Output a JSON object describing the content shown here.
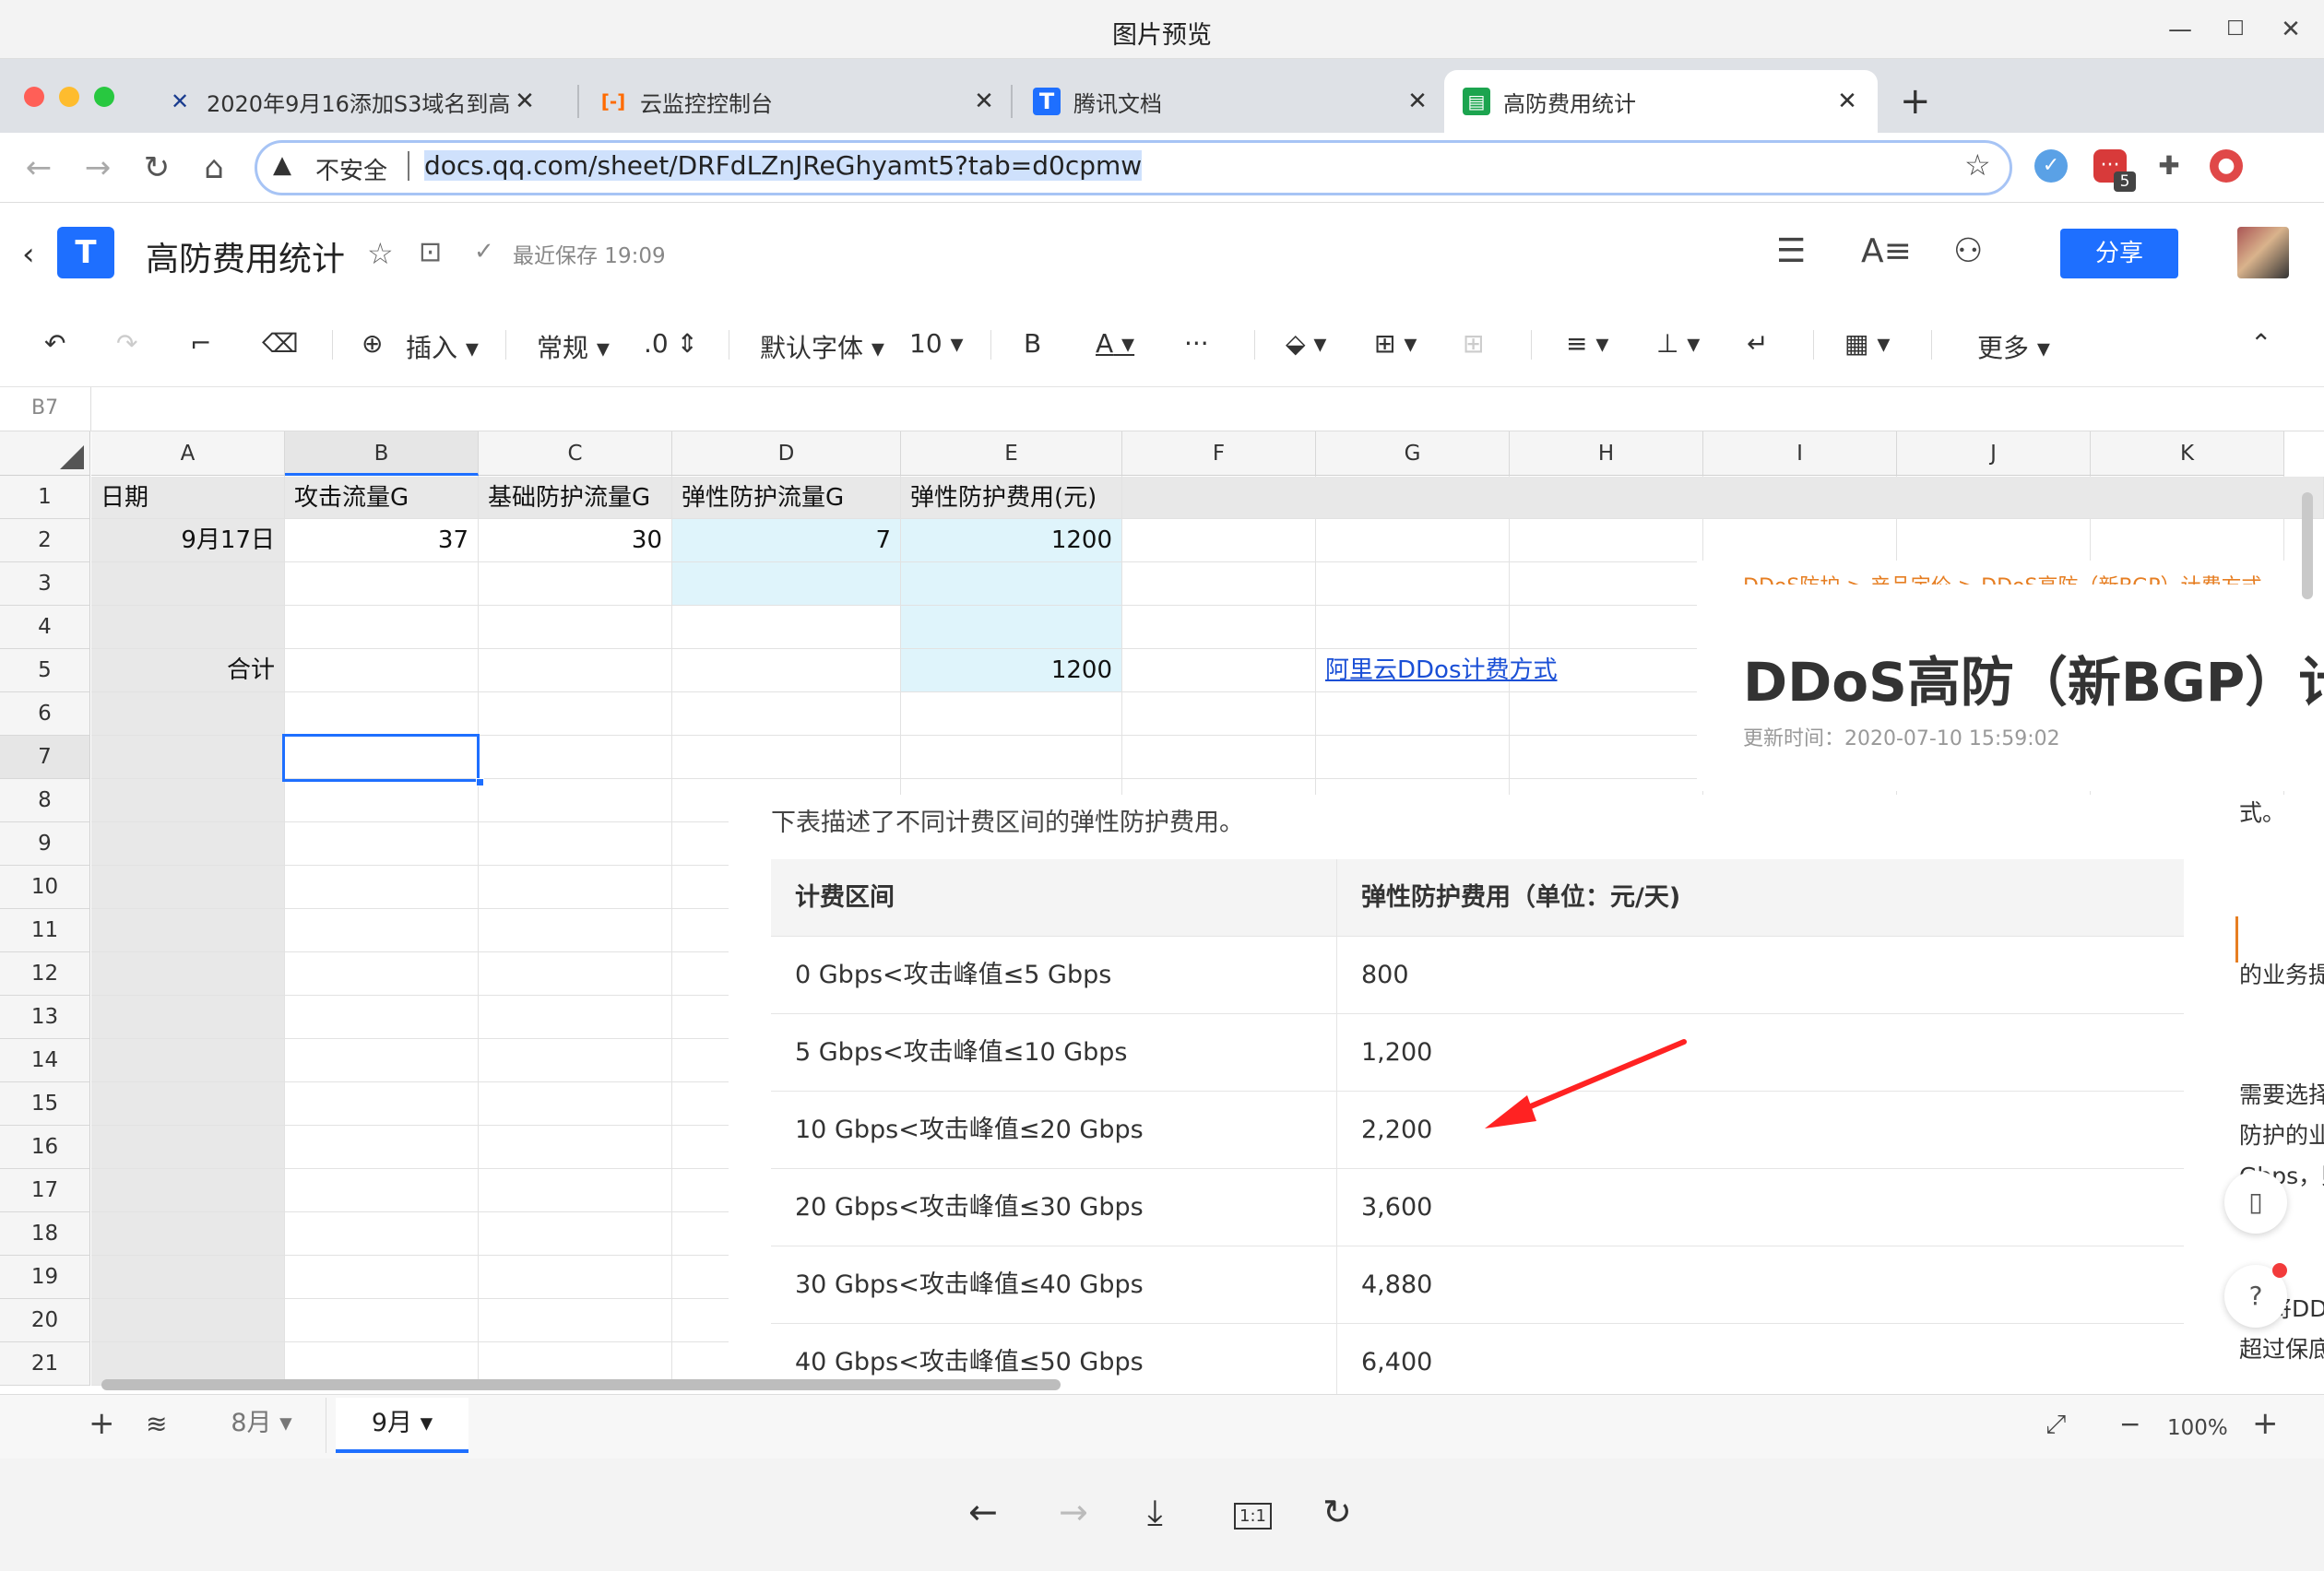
{
  "viewer": {
    "title": "图片预览",
    "minimize": "—",
    "maximize": "☐",
    "close": "✕",
    "footer": {
      "prev": "←",
      "next": "→",
      "download": "⤓",
      "actual_size": "1:1",
      "rotate": "↻"
    }
  },
  "browser": {
    "tabs": [
      {
        "label": "2020年9月16添加S3域名到高防",
        "icon": "✕",
        "close": "✕"
      },
      {
        "label": "云监控控制台",
        "icon": "[-]",
        "close": "✕"
      },
      {
        "label": "腾讯文档",
        "icon": "T",
        "close": "✕"
      },
      {
        "label": "高防费用统计",
        "icon": "▤",
        "close": "✕"
      }
    ],
    "new_tab": "+",
    "security": "不安全",
    "url": "docs.qq.com/sheet/DRFdLZnJReGhyamt5?tab=d0cpmw",
    "extension_badge": "5",
    "colors": {
      "accent": "#1e6fff",
      "tabbar": "#dee1e6",
      "traffic_red": "#ff5f57",
      "traffic_yellow": "#febc2e",
      "traffic_green": "#28c840"
    }
  },
  "doc": {
    "title": "高防费用统计",
    "save_status": "最近保存 19:09",
    "share": "分享"
  },
  "toolbar": {
    "insert": "插入",
    "format": "常规",
    "decimal": ".0",
    "font": "默认字体",
    "font_size": "10",
    "bold": "B",
    "font_color": "A",
    "more_dots": "···",
    "more": "更多"
  },
  "formula_bar": {
    "cell_ref": "B7"
  },
  "sheet": {
    "columns": [
      "A",
      "B",
      "C",
      "D",
      "E",
      "F",
      "G",
      "H",
      "I",
      "J",
      "K"
    ],
    "rows": [
      "1",
      "2",
      "3",
      "4",
      "5",
      "6",
      "7",
      "8",
      "9",
      "10",
      "11",
      "12",
      "13",
      "14",
      "15",
      "16",
      "17",
      "18",
      "19",
      "20",
      "21"
    ],
    "header_row": [
      "日期",
      "攻击流量G",
      "基础防护流量G",
      "弹性防护流量G",
      "弹性防护费用(元)"
    ],
    "row2": {
      "date": "9月17日",
      "attack": "37",
      "base": "30",
      "elastic": "7",
      "fee": "1200"
    },
    "row5": {
      "label": "合计",
      "fee": "1200",
      "link": "阿里云DDos计费方式"
    },
    "tabs": [
      "8月",
      "9月"
    ],
    "zoom": "100%"
  },
  "overlay": {
    "breadcrumb": "DDoS防护 > 产品定价 > DDoS高防（新BGP）计费方式",
    "title": "DDoS高防（新BGP）计",
    "updated": "更新时间：2020-07-10 15:59:02",
    "intro": "下表描述了不同计费区间的弹性防护费用。",
    "table": {
      "headers": [
        "计费区间",
        "弹性防护费用（单位：元/天)"
      ],
      "rows": [
        [
          "0 Gbps<攻击峰值≤5 Gbps",
          "800"
        ],
        [
          "5 Gbps<攻击峰值≤10 Gbps",
          "1,200"
        ],
        [
          "10 Gbps<攻击峰值≤20 Gbps",
          "2,200"
        ],
        [
          "20 Gbps<攻击峰值≤30 Gbps",
          "3,600"
        ],
        [
          "30 Gbps<攻击峰值≤40 Gbps",
          "4,880"
        ],
        [
          "40 Gbps<攻击峰值≤50 Gbps",
          "6,400"
        ]
      ]
    },
    "side_text": [
      "式。",
      "的业务提",
      "需要选择",
      "防护的业",
      "Gbps，则",
      "将DD",
      "超过保底"
    ],
    "help": "?"
  }
}
